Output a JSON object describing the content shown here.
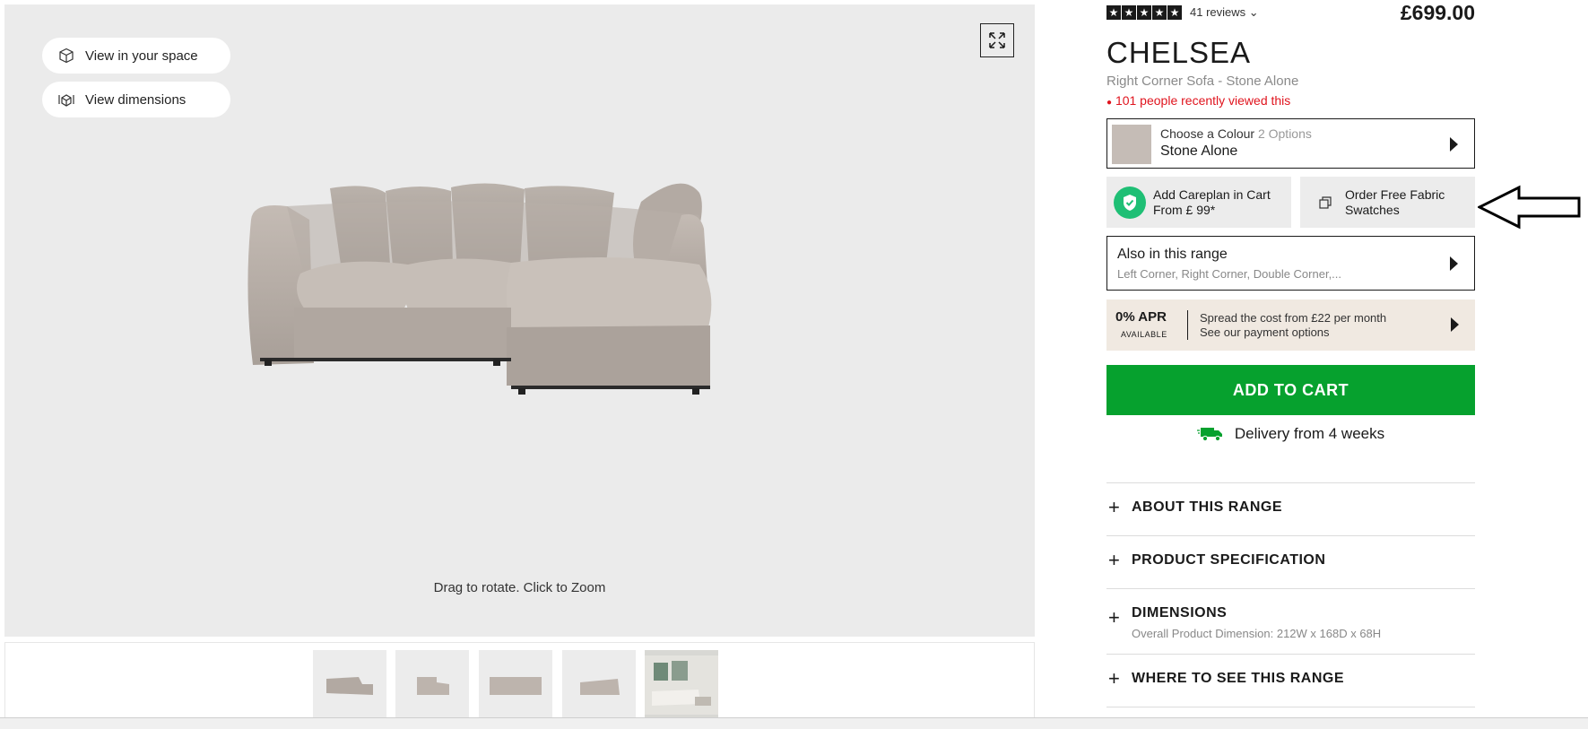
{
  "gallery": {
    "view_space_label": "View in your space",
    "view_dimensions_label": "View dimensions",
    "drag_hint": "Drag to rotate. Click to Zoom",
    "thumbnail_count": 5
  },
  "product": {
    "rating_stars": 5,
    "reviews_label": "41 reviews",
    "price": "£699.00",
    "name": "CHELSEA",
    "subtitle": "Right Corner Sofa - Stone Alone",
    "viewed_text": "101 people recently viewed this",
    "colour": {
      "label": "Choose a Colour",
      "options": "2 Options",
      "value": "Stone Alone",
      "swatch_color": "#c5bcb6"
    },
    "careplan": {
      "line1": "Add Careplan in Cart",
      "line2": "From £ 99*"
    },
    "swatches": {
      "line1": "Order Free Fabric",
      "line2": "Swatches"
    },
    "range": {
      "title": "Also in this range",
      "items": "Left Corner, Right Corner, Double Corner,..."
    },
    "apr": {
      "big": "0% APR",
      "small": "AVAILABLE",
      "line1": "Spread the cost from £22 per month",
      "line2": "See our payment options"
    },
    "add_to_cart": "ADD TO CART",
    "delivery": "Delivery from 4 weeks",
    "accordions": [
      {
        "title": "ABOUT THIS RANGE"
      },
      {
        "title": "PRODUCT SPECIFICATION"
      },
      {
        "title": "DIMENSIONS",
        "sub": "Overall Product Dimension: 212W x 168D x 68H"
      },
      {
        "title": "WHERE TO SEE THIS RANGE"
      }
    ]
  },
  "colors": {
    "accent_green": "#06a12e",
    "careplan_green": "#1fbf75",
    "alert_red": "#e0141e",
    "apr_bg": "#f0e9e1"
  }
}
